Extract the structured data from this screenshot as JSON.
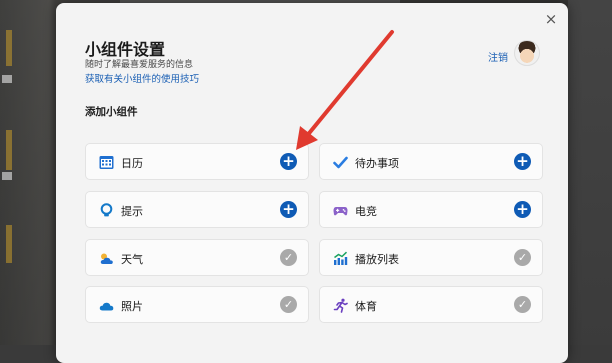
{
  "colors": {
    "accent": "#0f5bb5",
    "link": "#1a5fb4",
    "added": "#a9a9a9",
    "annotation_arrow": "#e03a2f"
  },
  "dialog": {
    "title": "小组件设置",
    "subtitle": "随时了解最喜爱服务的信息",
    "tips_link": "获取有关小组件的使用技巧",
    "sign_out": "注销",
    "section_title": "添加小组件",
    "close_icon": "×"
  },
  "widgets": [
    {
      "label": "日历",
      "icon": "calendar-icon",
      "state": "add",
      "action_glyph": "+"
    },
    {
      "label": "待办事项",
      "icon": "checkmark-icon",
      "state": "add",
      "action_glyph": "+"
    },
    {
      "label": "提示",
      "icon": "lightbulb-icon",
      "state": "add",
      "action_glyph": "+"
    },
    {
      "label": "电竞",
      "icon": "gamepad-icon",
      "state": "add",
      "action_glyph": "+"
    },
    {
      "label": "天气",
      "icon": "weather-icon",
      "state": "added",
      "action_glyph": "✓"
    },
    {
      "label": "播放列表",
      "icon": "chart-up-icon",
      "state": "added",
      "action_glyph": "✓"
    },
    {
      "label": "照片",
      "icon": "cloud-icon",
      "state": "added",
      "action_glyph": "✓"
    },
    {
      "label": "体育",
      "icon": "runner-icon",
      "state": "added",
      "action_glyph": "✓"
    }
  ]
}
